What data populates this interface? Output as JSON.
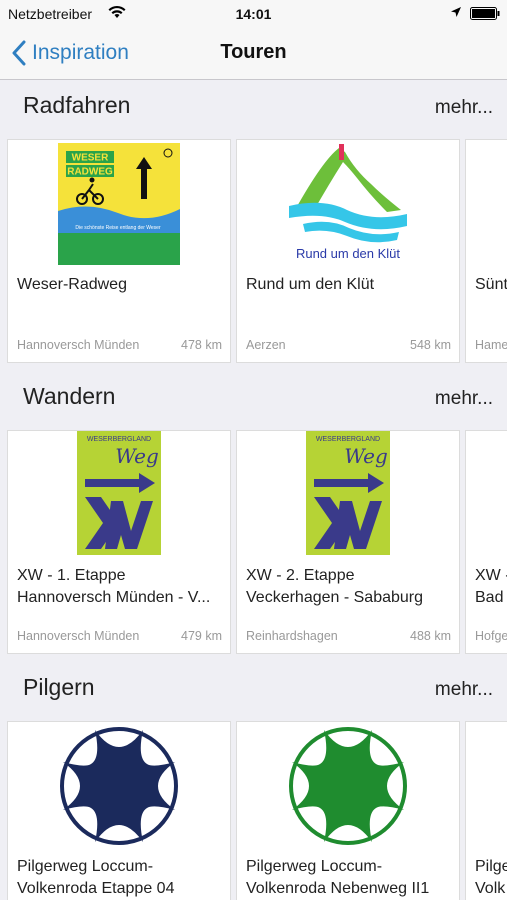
{
  "status": {
    "carrier": "Netzbetreiber",
    "time": "14:01"
  },
  "nav": {
    "back_label": "Inspiration",
    "title": "Touren"
  },
  "sections": [
    {
      "title": "Radfahren",
      "more": "mehr...",
      "cards": [
        {
          "title1": "Weser-Radweg",
          "title2": "",
          "location": "Hannoversch Münden",
          "distance": "478 km",
          "logo": {
            "top_text": "WESER",
            "bottom_text": "RADWEG",
            "tagline": "Die schönste Reise entlang der Weser"
          }
        },
        {
          "title1": "Rund um den Klüt",
          "title2": "",
          "location": "Aerzen",
          "distance": "548 km",
          "logo": {
            "caption": "Rund um den Klüt"
          }
        },
        {
          "title1": "Sünt",
          "title2": "",
          "location": "Hame",
          "distance": ""
        }
      ]
    },
    {
      "title": "Wandern",
      "more": "mehr...",
      "cards": [
        {
          "title1": "XW - 1. Etappe",
          "title2": "Hannoversch Münden - V...",
          "location": "Hannoversch Münden",
          "distance": "479 km",
          "logo": {
            "top_text": "WESERBERGLAND",
            "script_text": "Weg"
          }
        },
        {
          "title1": "XW - 2. Etappe",
          "title2": "Veckerhagen - Sababurg",
          "location": "Reinhardshagen",
          "distance": "488 km",
          "logo": {
            "top_text": "WESERBERGLAND",
            "script_text": "Weg"
          }
        },
        {
          "title1": "XW -",
          "title2": "Bad",
          "location": "Hofge",
          "distance": ""
        }
      ]
    },
    {
      "title": "Pilgern",
      "more": "mehr...",
      "cards": [
        {
          "title1": "Pilgerweg Loccum-",
          "title2": "Volkenroda Etappe 04",
          "location": "",
          "distance": "",
          "color": "#1b2a5c"
        },
        {
          "title1": "Pilgerweg Loccum-",
          "title2": "Volkenroda Nebenweg II1",
          "location": "",
          "distance": "",
          "color": "#1f8c2f"
        },
        {
          "title1": "Pilge",
          "title2": "Volk",
          "location": "",
          "distance": ""
        }
      ]
    }
  ]
}
